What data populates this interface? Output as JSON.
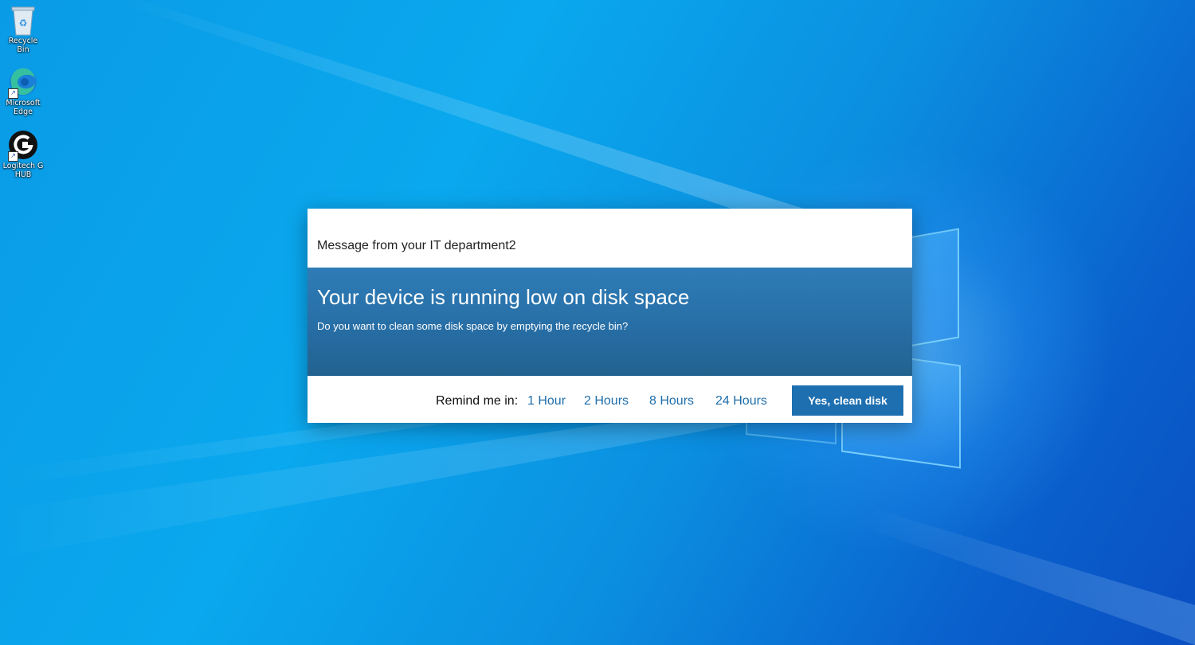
{
  "desktop": {
    "icons": [
      {
        "name": "recycle-bin",
        "label": "Recycle Bin"
      },
      {
        "name": "microsoft-edge",
        "label": "Microsoft Edge"
      },
      {
        "name": "logitech-g-hub",
        "label": "Logitech G HUB"
      }
    ]
  },
  "dialog": {
    "source": "Message from your IT department2",
    "title": "Your device is running low on disk space",
    "body": "Do you want to clean some disk space by emptying the recycle bin?",
    "remind_label": "Remind me in:",
    "remind_options": [
      "1 Hour",
      "2 Hours",
      "8 Hours",
      "24 Hours"
    ],
    "confirm_label": "Yes, clean disk"
  },
  "colors": {
    "banner": "#2a74ad",
    "accent_button": "#1e6fb0",
    "link": "#1f6eaa",
    "desktop": "#0a9be6"
  }
}
